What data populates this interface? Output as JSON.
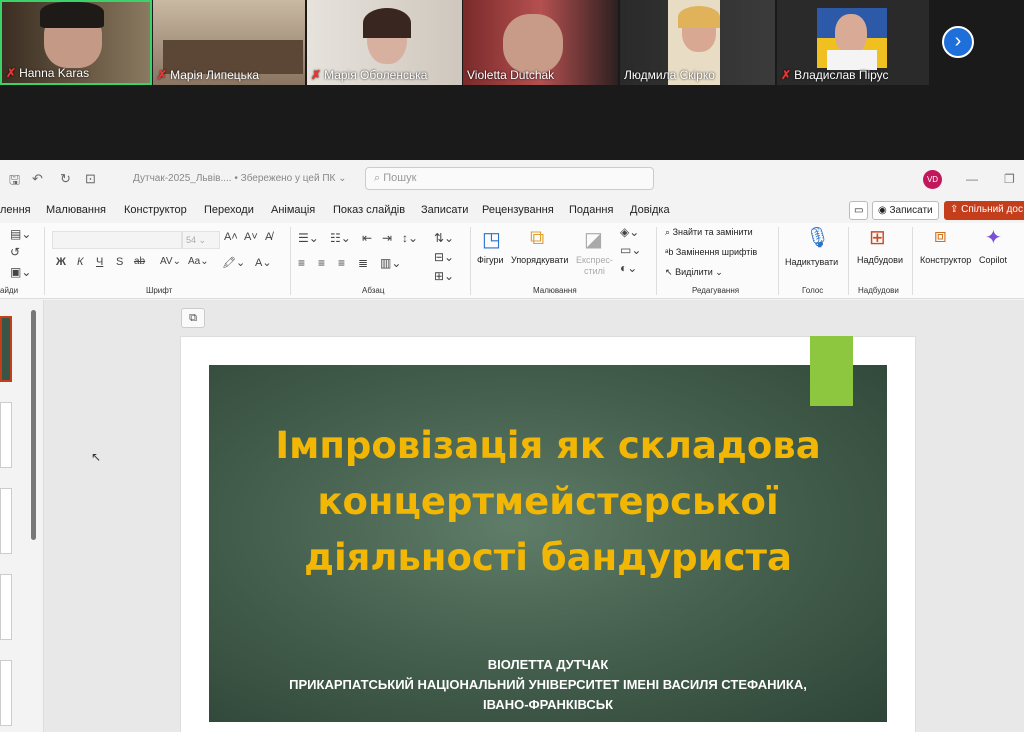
{
  "participants": [
    {
      "name": "Hanna Karas",
      "muted": true,
      "active": true
    },
    {
      "name": "Марія Липецька",
      "muted": true,
      "active": false
    },
    {
      "name": "Марія Оболенська",
      "muted": true,
      "active": false
    },
    {
      "name": "Violetta Dutchak",
      "muted": false,
      "active": false
    },
    {
      "name": "Людмила Скірко",
      "muted": false,
      "active": false
    },
    {
      "name": "Владислав Пірус",
      "muted": true,
      "active": false
    }
  ],
  "window": {
    "doc_title": "Дутчак-2025_Львів....",
    "save_status": "• Збережено у цей ПК",
    "search_placeholder": "Пошук",
    "avatar_initials": "VD"
  },
  "tabs": [
    "лення",
    "Малювання",
    "Конструктор",
    "Переходи",
    "Анімація",
    "Показ слайдів",
    "Записати",
    "Рецензування",
    "Подання",
    "Довідка"
  ],
  "header_buttons": {
    "record": "Записати",
    "share": "Спільний дос"
  },
  "ribbon": {
    "font_size": "54",
    "groups": {
      "slides": "айди",
      "font": "Шрифт",
      "paragraph": "Абзац",
      "drawing": "Малювання",
      "editing": "Редагування",
      "voice": "Голос",
      "addins": "Надбудови"
    },
    "buttons": {
      "shapes": "Фігури",
      "arrange": "Упорядкувати",
      "express_styles": "Експрес-\nстилі",
      "find_replace": "Знайти та замінити",
      "replace_fonts": "Замінення шрифтів",
      "select": "Виділити",
      "dictate": "Надиктувати",
      "addins": "Надбудови",
      "designer": "Конструктор",
      "copilot": "Copilot"
    }
  },
  "slide": {
    "title_lines": [
      "Імпровізація як складова",
      "концертмейстерської",
      "діяльності бандуриста"
    ],
    "author": "ВІОЛЕТТА ДУТЧАК",
    "institution": "ПРИКАРПАТСЬКИЙ НАЦІОНАЛЬНИЙ УНІВЕРСИТЕТ ІМЕНІ ВАСИЛЯ СТЕФАНИКА,",
    "city": "ІВАНО-ФРАНКІВСЬК"
  },
  "colors": {
    "title": "#f2b705",
    "slide_bg": "#46614f",
    "accent": "#8dc63f",
    "share": "#c43e1c"
  }
}
